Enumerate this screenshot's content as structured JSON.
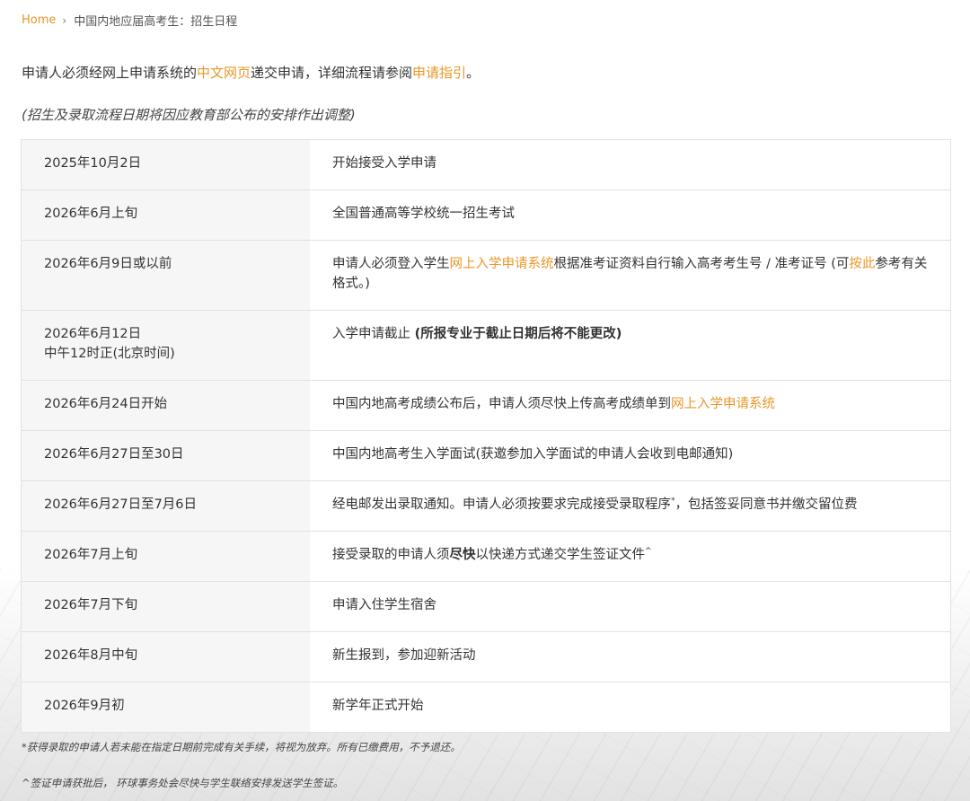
{
  "breadcrumb": {
    "home": "Home",
    "current": "中国内地应届高考生：招生日程"
  },
  "intro": {
    "text_1": "申请人必须经网上申请系统的",
    "link_1": "中文网页",
    "text_2": "递交申请，详细流程请参阅",
    "link_2": "申请指引",
    "text_3": "。"
  },
  "note": "(招生及录取流程日期将因应教育部公布的安排作出调整)",
  "schedule": [
    {
      "date": "2025年10月2日",
      "event": "开始接受入学申请"
    },
    {
      "date": "2026年6月上旬",
      "event": "全国普通高等学校统一招生考试"
    },
    {
      "date": "2026年6月9日或以前",
      "event_1": "申请人必须登入学生",
      "event_link_1": "网上入学申请系统",
      "event_2": "根据准考证资料自行输入高考考生号 / 准考证号 (可",
      "event_link_2": "按此",
      "event_3": "参考有关格式。)"
    },
    {
      "date_line_1": "2026年6月12日",
      "date_line_2": "中午12时正(北京时间)",
      "event_1": "入学申请截止 ",
      "event_bold": "(所报专业于截止日期后将不能更改)"
    },
    {
      "date": "2026年6月24日开始",
      "event_1": "中国内地高考成绩公布后，申请人须尽快上传高考成绩单到",
      "event_link_1": "网上入学申请系统"
    },
    {
      "date": "2026年6月27日至30日",
      "event": "中国内地高考生入学面试(获邀参加入学面试的申请人会收到电邮通知)"
    },
    {
      "date": "2026年6月27日至7月6日",
      "event_1": "经电邮发出录取通知。申请人必须按要求完成接受录取程序",
      "event_sup": "*",
      "event_2": "，包括签妥同意书并缴交留位费"
    },
    {
      "date": "2026年7月上旬",
      "event_1": "接受录取的申请人须",
      "event_bold": "尽快",
      "event_2": "以快递方式递交学生签证文件",
      "event_sup": "^"
    },
    {
      "date": "2026年7月下旬",
      "event": "申请入住学生宿舍"
    },
    {
      "date": "2026年8月中旬",
      "event": "新生报到，参加迎新活动"
    },
    {
      "date": "2026年9月初",
      "event": "新学年正式开始"
    }
  ],
  "footnotes": {
    "asterisk": "*获得录取的申请人若未能在指定日期前完成有关手续，将视为放弃。所有已缴费用，不予退还。",
    "caret": "^签证申请获批后， 环球事务处会尽快与学生联络安排发送学生签证。"
  },
  "colors": {
    "link": "#e8972a",
    "date_cell_bg": "#f6f6f6",
    "border": "#e2e2e2",
    "text": "#333333"
  },
  "icons": {
    "breadcrumb_separator": "chevron-right-icon"
  }
}
